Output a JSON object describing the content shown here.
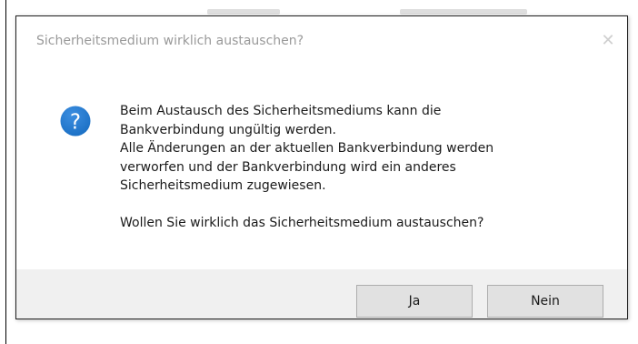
{
  "dialog": {
    "title": "Sicherheitsmedium wirklich austauschen?",
    "close_glyph": "✕",
    "icon": "question-icon",
    "icon_color": "#1a6fc4",
    "message_lines": [
      "Beim Austausch des Sicherheitsmediums kann die",
      "Bankverbindung ungültig werden.",
      "Alle Änderungen an der aktuellen Bankverbindung werden",
      "verworfen und der Bankverbindung wird ein anderes",
      "Sicherheitsmedium zugewiesen."
    ],
    "question": "Wollen Sie wirklich das Sicherheitsmedium austauschen?",
    "buttons": {
      "yes_label": "Ja",
      "no_label": "Nein"
    }
  }
}
